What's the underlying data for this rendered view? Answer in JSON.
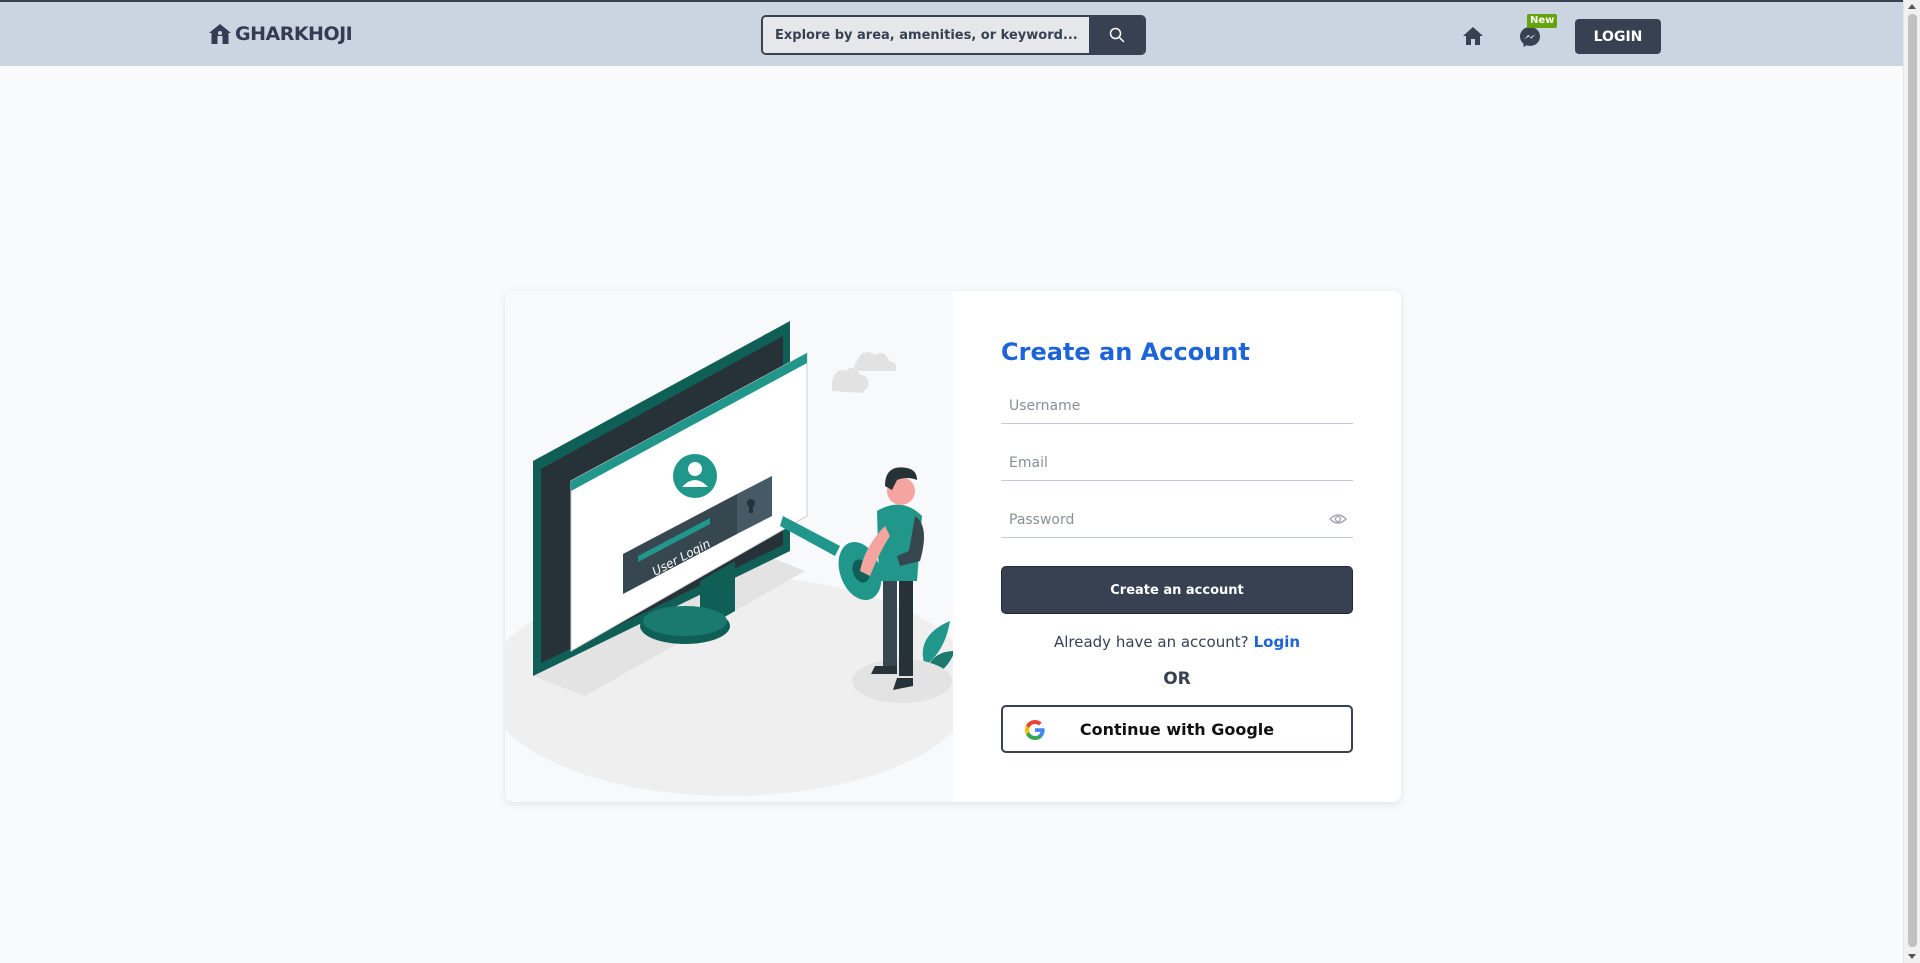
{
  "header": {
    "brand": "GHARKHOJI",
    "search_placeholder": "Explore by area, amenities, or keyword...",
    "new_badge": "New",
    "login_label": "LOGIN"
  },
  "illustration": {
    "screen_label": "User Login"
  },
  "form": {
    "title": "Create an Account",
    "username_placeholder": "Username",
    "email_placeholder": "Email",
    "password_placeholder": "Password",
    "submit_label": "Create an account",
    "already_text": "Already have an account?",
    "login_link": "Login",
    "or_text": "OR",
    "google_label": "Continue with Google"
  },
  "colors": {
    "nav_bg": "#cbd5e1",
    "dark": "#374151",
    "accent_blue": "#1d64d8",
    "teal": "#0f766e",
    "badge_green": "#65a30d"
  }
}
